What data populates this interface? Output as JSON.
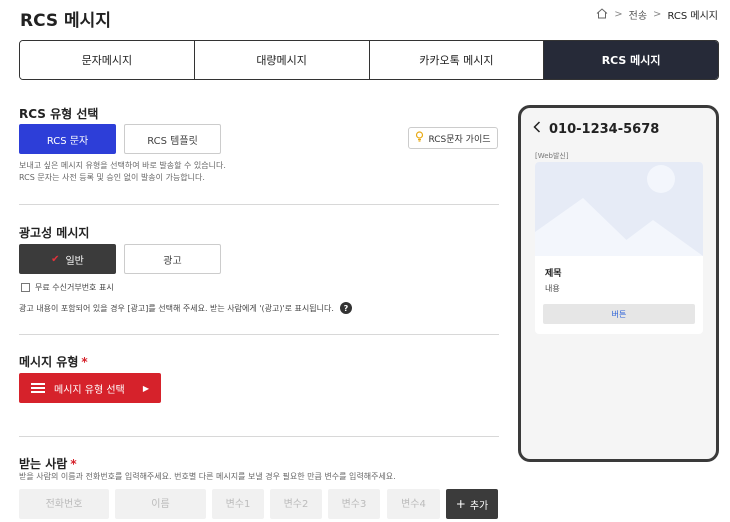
{
  "page": {
    "title": "RCS 메시지"
  },
  "breadcrumb": {
    "items": [
      "전송",
      "RCS 메시지"
    ]
  },
  "tabs": [
    {
      "label": "문자메시지",
      "active": false
    },
    {
      "label": "대량메시지",
      "active": false
    },
    {
      "label": "카카오톡 메시지",
      "active": false
    },
    {
      "label": "RCS 메시지",
      "active": true
    }
  ],
  "rcs_type": {
    "title": "RCS 유형 선택",
    "options": [
      {
        "label": "RCS 문자",
        "selected": true
      },
      {
        "label": "RCS 템플릿",
        "selected": false
      }
    ],
    "guide_button": "RCS문자 가이드",
    "help_line1": "보내고 싶은 메시지 유형을 선택하여 바로 발송할 수 있습니다.",
    "help_line2": "RCS 문자는 사전 등록 및 승인 없이 발송이 가능합니다."
  },
  "ad_message": {
    "title": "광고성 메시지",
    "options": [
      {
        "label": "일반",
        "selected": true
      },
      {
        "label": "광고",
        "selected": false
      }
    ],
    "checkbox_label": "무료 수신거부번호 표시",
    "checkbox_checked": false,
    "note": "광고 내용이 포함되어 있을 경우 [광고]를 선택해 주세요. 받는 사람에게 '(광고)'로 표시됩니다."
  },
  "message_type": {
    "title": "메시지 유형",
    "required_mark": "*",
    "select_button": "메시지 유형 선택"
  },
  "recipients": {
    "title": "받는 사람",
    "required_mark": "*",
    "help": "받을 사람의 이름과 전화번호를 입력해주세요. 번호별 다른 메시지를 보낼 경우 필요한 만큼 변수를 입력해주세요.",
    "placeholders": {
      "phone": "전화번호",
      "name": "이름",
      "var1": "변수1",
      "var2": "변수2",
      "var3": "변수3",
      "var4": "변수4"
    },
    "add_button": "추가"
  },
  "preview": {
    "phone_number": "010-1234-5678",
    "web_tag": "[Web발신]",
    "card_title": "제목",
    "card_body": "내용",
    "card_button": "버튼"
  },
  "colors": {
    "accent_blue": "#2d3ed8",
    "accent_red": "#d6222b",
    "dark": "#262a38",
    "link_blue": "#2d63d8"
  },
  "icons": {
    "home": "home-icon",
    "bulb": "bulb-icon",
    "question": "question-icon",
    "back": "chevron-left-icon",
    "image_placeholder": "image-placeholder-icon",
    "list": "list-icon",
    "check": "check-icon",
    "arrow": "caret-right-icon",
    "plus": "plus-icon"
  }
}
